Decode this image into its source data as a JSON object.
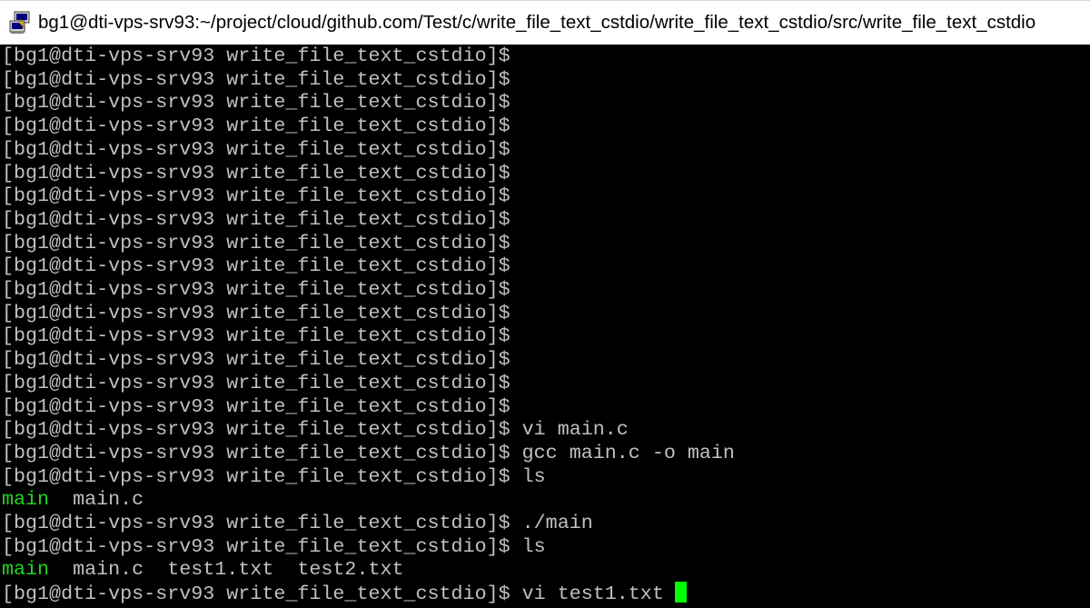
{
  "window": {
    "title": "bg1@dti-vps-srv93:~/project/cloud/github.com/Test/c/write_file_text_cstdio/write_file_text_cstdio/src/write_file_text_cstdio",
    "icon": "putty-terminal-icon"
  },
  "colors": {
    "background": "#000000",
    "text": "#c0c0c0",
    "executable": "#22d422",
    "cursor": "#00ff00",
    "titlebar": "#ffffff"
  },
  "terminal": {
    "prompt": "[bg1@dti-vps-srv93 write_file_text_cstdio]$",
    "lines": [
      {
        "type": "prompt",
        "command": ""
      },
      {
        "type": "prompt",
        "command": ""
      },
      {
        "type": "prompt",
        "command": ""
      },
      {
        "type": "prompt",
        "command": ""
      },
      {
        "type": "prompt",
        "command": ""
      },
      {
        "type": "prompt",
        "command": ""
      },
      {
        "type": "prompt",
        "command": ""
      },
      {
        "type": "prompt",
        "command": ""
      },
      {
        "type": "prompt",
        "command": ""
      },
      {
        "type": "prompt",
        "command": ""
      },
      {
        "type": "prompt",
        "command": ""
      },
      {
        "type": "prompt",
        "command": ""
      },
      {
        "type": "prompt",
        "command": ""
      },
      {
        "type": "prompt",
        "command": ""
      },
      {
        "type": "prompt",
        "command": ""
      },
      {
        "type": "prompt",
        "command": ""
      },
      {
        "type": "prompt",
        "command": "vi main.c"
      },
      {
        "type": "prompt",
        "command": "gcc main.c -o main"
      },
      {
        "type": "prompt",
        "command": "ls"
      },
      {
        "type": "output",
        "items": [
          {
            "text": "main",
            "kind": "exec"
          },
          {
            "text": "  main.c",
            "kind": "file"
          }
        ]
      },
      {
        "type": "prompt",
        "command": "./main"
      },
      {
        "type": "prompt",
        "command": "ls"
      },
      {
        "type": "output",
        "items": [
          {
            "text": "main",
            "kind": "exec"
          },
          {
            "text": "  main.c  test1.txt  test2.txt",
            "kind": "file"
          }
        ]
      },
      {
        "type": "prompt",
        "command": "vi test1.txt",
        "cursor": true
      }
    ]
  }
}
